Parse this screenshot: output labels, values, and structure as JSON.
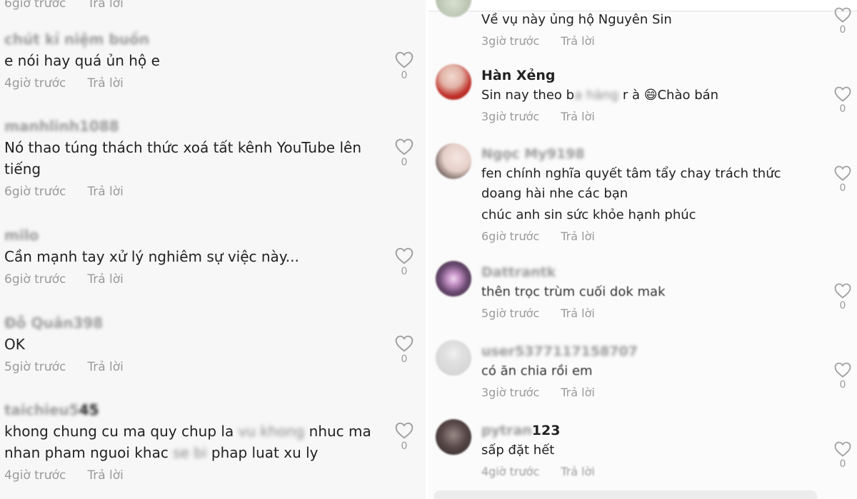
{
  "left": {
    "top_partial": {
      "time": "6giờ trước",
      "reply": "Trả lời"
    },
    "comments": [
      {
        "user": "chút kỉ niệm buồn",
        "text": "e nói hay quá ủn hộ e",
        "time": "4giờ trước",
        "reply": "Trả lời",
        "likes": "0"
      },
      {
        "user": "manhlinh1088",
        "text": "Nó thao túng thách thức xoá tất kênh YouTube lên tiếng",
        "time": "6giờ trước",
        "reply": "Trả lời",
        "likes": "0"
      },
      {
        "user": "milo",
        "text": "Cần mạnh tay xử lý nghiêm sự việc này...",
        "time": "6giờ trước",
        "reply": "Trả lời",
        "likes": "0"
      },
      {
        "user": "Đỗ Quân398",
        "text": "OK",
        "time": "5giờ trước",
        "reply": "Trả lời",
        "likes": "0"
      },
      {
        "user_blur": "taichieu5",
        "user_clear": "45",
        "text_a": "khong chung cu ma quy chup la ",
        "text_b": "vu khong",
        "text_c": " nhuc ma nhan pham nguoi khac ",
        "text_d": "se bi",
        "text_e": " phap luat xu ly",
        "time": "4giờ trước",
        "reply": "Trả lời",
        "likes": "0"
      }
    ]
  },
  "right": {
    "comments": [
      {
        "text": "Về vụ này ủng hộ Nguyên Sin",
        "time": "3giờ trước",
        "reply": "Trả lời",
        "likes": "0"
      },
      {
        "user": "Hàn Xẻng",
        "text_a": "Sin nay theo b",
        "text_b": "a hàng",
        "text_c": " r à ",
        "emoji": "😄",
        "text_d": "Chào bán",
        "time": "3giờ trước",
        "reply": "Trả lời",
        "likes": "0"
      },
      {
        "user": "Ngọc My9198",
        "text": "fen chính nghĩa quyết tâm tẩy chay trách thức doang hài nhe các bạn",
        "text2": "chúc anh sin sức khỏe hạnh phúc",
        "time": "6giờ trước",
        "reply": "Trả lời",
        "likes": "0"
      },
      {
        "user": "Dattrantk",
        "text": "thên trọc trùm cuối dok mak",
        "time": "5giờ trước",
        "reply": "Trả lời",
        "likes": "0"
      },
      {
        "user": "user5377117158707",
        "text": "có ăn chia rồi em",
        "time": "3giờ trước",
        "reply": "Trả lời",
        "likes": "0"
      },
      {
        "user_blur": "pytran",
        "user_clear": "123",
        "text": "sấp đặt hết",
        "time": "4giờ trước",
        "reply": "Trả lời",
        "likes": "0"
      }
    ]
  },
  "colors": {
    "text": "#222222",
    "meta": "#9a9a9a",
    "like": "#a0a0a0",
    "left_bg": "#f7f7f7",
    "right_bg": "#fbfbfb"
  },
  "icons": {
    "like": "heart-outline-icon"
  }
}
